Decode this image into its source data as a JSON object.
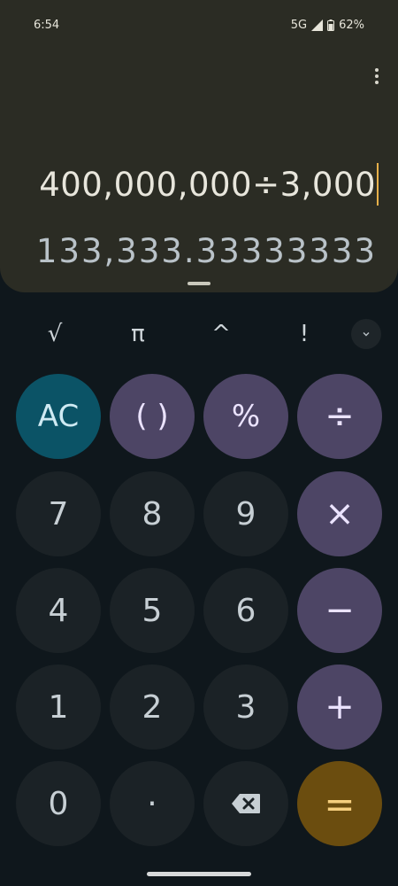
{
  "status_bar": {
    "time": "6:54",
    "network": "5G",
    "battery": "62%"
  },
  "display": {
    "expression": "400,000,000÷3,000",
    "result": "133,333.33333333"
  },
  "scientific_keys": [
    "√",
    "π",
    "^",
    "!"
  ],
  "keypad": {
    "ac": "AC",
    "parens": "( )",
    "percent": "%",
    "divide": "÷",
    "seven": "7",
    "eight": "8",
    "nine": "9",
    "multiply": "×",
    "four": "4",
    "five": "5",
    "six": "6",
    "minus": "−",
    "one": "1",
    "two": "2",
    "three": "3",
    "plus": "+",
    "zero": "0",
    "decimal": "·",
    "equals": "="
  },
  "colors": {
    "display_bg": "#2b2c24",
    "operator_key": "#4d4565",
    "ac_key": "#0b5366",
    "equals_key": "#6b4d0f",
    "digit_key": "#1b2226",
    "cursor": "#e7b04a"
  }
}
